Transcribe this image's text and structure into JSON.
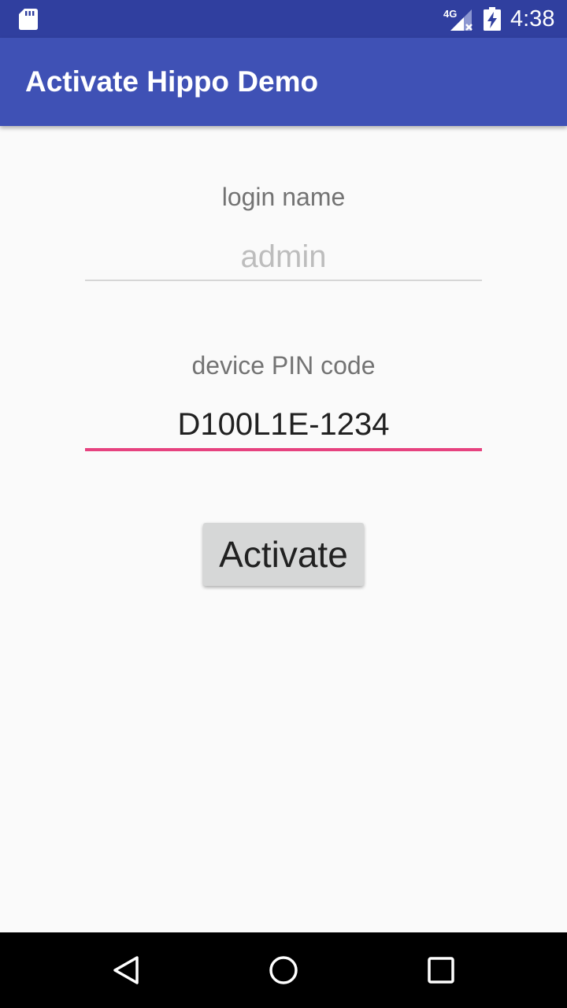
{
  "status_bar": {
    "time": "4:38",
    "network_label": "4G",
    "icons": [
      "sd-card-icon",
      "signal-4g-icon",
      "battery-charging-icon"
    ]
  },
  "app_bar": {
    "title": "Activate Hippo Demo"
  },
  "form": {
    "login_label": "login name",
    "login_value": "",
    "login_placeholder": "admin",
    "pin_label": "device PIN code",
    "pin_value": "D100L1E-1234",
    "activate_label": "Activate"
  },
  "nav_bar": {
    "icons": [
      "back-icon",
      "home-icon",
      "recents-icon"
    ]
  },
  "colors": {
    "status_bar": "#303f9f",
    "app_bar": "#3f51b5",
    "accent": "#e6427f",
    "background": "#fafafa",
    "button": "#d6d7d7"
  }
}
